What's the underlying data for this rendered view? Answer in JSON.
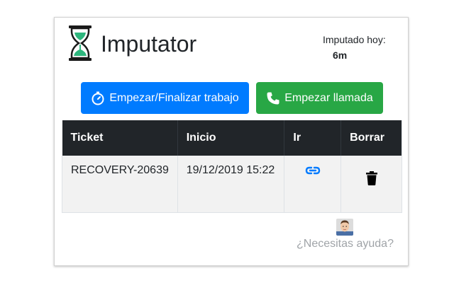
{
  "app": {
    "title": "Imputator",
    "today_label": "Imputado hoy:",
    "today_value": "6m"
  },
  "toolbar": {
    "start_work_label": "Empezar/Finalizar trabajo",
    "start_call_label": "Empezar llamada"
  },
  "table": {
    "headers": [
      "Ticket",
      "Inicio",
      "Ir",
      "Borrar"
    ],
    "rows": [
      {
        "ticket": "RECOVERY-20639",
        "inicio": "19/12/2019 15:22"
      }
    ]
  },
  "help": {
    "label": "¿Necesitas ayuda?"
  },
  "colors": {
    "primary": "#007bff",
    "success": "#28a745",
    "table_header": "#212529",
    "row_bg": "#f2f2f2",
    "help_text": "#a0a4a8"
  },
  "icons": {
    "logo": "hourglass-icon",
    "start_work": "stopwatch-icon",
    "start_call": "phone-icon",
    "go": "link-icon",
    "delete": "trash-icon"
  }
}
